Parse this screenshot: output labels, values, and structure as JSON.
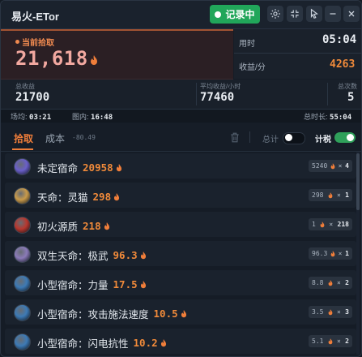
{
  "window": {
    "title": "易火-ETor"
  },
  "toolbar": {
    "record_label": "记录中",
    "buttons": [
      "gear-icon",
      "compress-icon",
      "cursor-icon",
      "minimize-icon",
      "close-icon"
    ]
  },
  "stats": {
    "current_pickup_label": "当前拾取",
    "current_pickup_value": "21,618",
    "duration_label": "用时",
    "duration_value": "05:04",
    "rate_label": "收益/分",
    "rate_value": "4263",
    "total_income_label": "总收益",
    "total_income_value": "21700",
    "avg_hourly_label": "平均收益/小时",
    "avg_hourly_value": "77460",
    "total_runs_label": "总次数",
    "total_runs_value": "5"
  },
  "timing": {
    "scene_label": "场均:",
    "scene_value": "03:21",
    "map_label": "图内:",
    "map_value": "16:48",
    "total_label": "总时长:",
    "total_value": "55:04"
  },
  "tabs": {
    "pick": "拾取",
    "cost": "成本",
    "cost_value": "-80.49",
    "total_switch_label": "总计",
    "total_switch_on": false,
    "tax_switch_label": "计税",
    "tax_switch_on": true
  },
  "items": [
    {
      "name": "未定宿命",
      "value": "20958",
      "badge_left": "5240",
      "badge_right": "4",
      "icon_color": "#6a5fc9"
    },
    {
      "name": "天命：灵猫",
      "value": "298",
      "badge_left": "298",
      "badge_right": "1",
      "icon_color": "#c99a4a"
    },
    {
      "name": "初火源质",
      "value": "218",
      "badge_left": "1",
      "badge_right": "218",
      "icon_color": "#b8372e"
    },
    {
      "name": "双生天命：极武",
      "value": "96.3",
      "badge_left": "96.3",
      "badge_right": "1",
      "icon_color": "#8a7ab8"
    },
    {
      "name": "小型宿命：力量",
      "value": "17.5",
      "badge_left": "8.8",
      "badge_right": "2",
      "icon_color": "#3d7ab5"
    },
    {
      "name": "小型宿命：攻击施法速度",
      "value": "10.5",
      "badge_left": "3.5",
      "badge_right": "3",
      "icon_color": "#3d7ab5"
    },
    {
      "name": "小型宿命：闪电抗性",
      "value": "10.2",
      "badge_left": "5.1",
      "badge_right": "2",
      "icon_color": "#3d7ab5"
    }
  ],
  "colors": {
    "accent": "#f07e3a",
    "record_green": "#21a65a",
    "tax_switch_green": "#2fa05a"
  }
}
